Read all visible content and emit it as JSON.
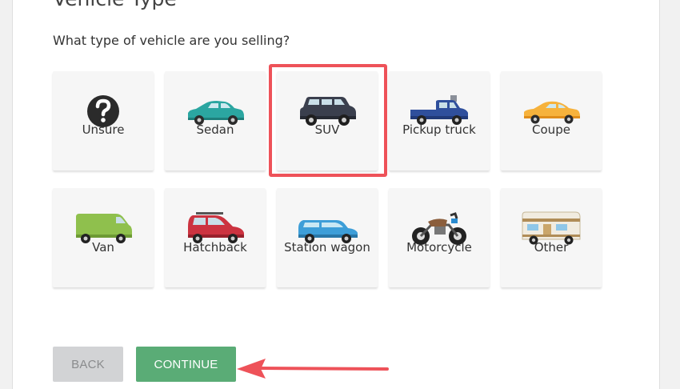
{
  "page": {
    "heading": "Vehicle Type",
    "question": "What type of vehicle are you selling?"
  },
  "vehicles": [
    {
      "label": "Unsure",
      "icon": "question-icon",
      "selected": false
    },
    {
      "label": "Sedan",
      "icon": "sedan-icon",
      "selected": false
    },
    {
      "label": "SUV",
      "icon": "suv-icon",
      "selected": true
    },
    {
      "label": "Pickup truck",
      "icon": "pickup-truck-icon",
      "selected": false
    },
    {
      "label": "Coupe",
      "icon": "coupe-icon",
      "selected": false
    },
    {
      "label": "Van",
      "icon": "van-icon",
      "selected": false
    },
    {
      "label": "Hatchback",
      "icon": "hatchback-icon",
      "selected": false
    },
    {
      "label": "Station wagon",
      "icon": "station-wagon-icon",
      "selected": false
    },
    {
      "label": "Motorcycle",
      "icon": "motorcycle-icon",
      "selected": false
    },
    {
      "label": "Other",
      "icon": "rv-icon",
      "selected": false
    }
  ],
  "buttons": {
    "back_label": "BACK",
    "continue_label": "CONTINUE"
  },
  "colors": {
    "highlight": "#ee5259",
    "continue": "#5aac76",
    "back": "#d2d3d5"
  }
}
